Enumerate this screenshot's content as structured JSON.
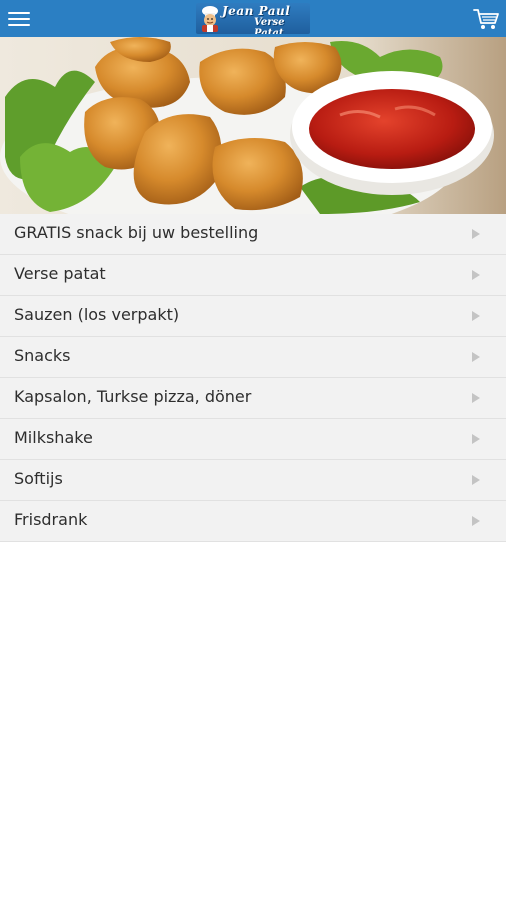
{
  "header": {
    "menu_icon": "hamburger-menu-icon",
    "logo": {
      "line1": "Jean Paul",
      "line2": "Verse Patat",
      "icon": "chef-icon"
    },
    "cart_icon": "shopping-cart-icon",
    "background_color": "#2b7fc3"
  },
  "hero": {
    "image": "chicken nuggets with ketchup dip on lettuce"
  },
  "categories": [
    {
      "label": "GRATIS snack bij uw bestelling",
      "icon": "chevron-right-icon"
    },
    {
      "label": "Verse patat",
      "icon": "chevron-right-icon"
    },
    {
      "label": "Sauzen (los verpakt)",
      "icon": "chevron-right-icon"
    },
    {
      "label": "Snacks",
      "icon": "chevron-right-icon"
    },
    {
      "label": "Kapsalon, Turkse pizza, döner",
      "icon": "chevron-right-icon"
    },
    {
      "label": "Milkshake",
      "icon": "chevron-right-icon"
    },
    {
      "label": "Softijs",
      "icon": "chevron-right-icon"
    },
    {
      "label": "Frisdrank",
      "icon": "chevron-right-icon"
    }
  ]
}
